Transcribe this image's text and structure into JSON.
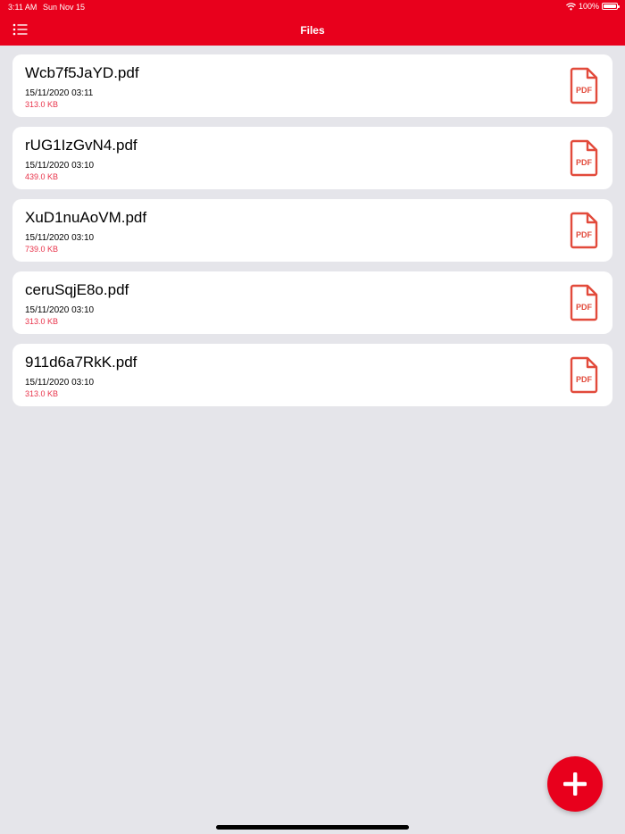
{
  "status_bar": {
    "time": "3:11 AM",
    "date": "Sun Nov 15",
    "battery": "100%"
  },
  "header": {
    "title": "Files"
  },
  "files": [
    {
      "name": "Wcb7f5JaYD.pdf",
      "date": "15/11/2020 03:11",
      "size": "313.0 KB",
      "icon_label": "PDF"
    },
    {
      "name": "rUG1IzGvN4.pdf",
      "date": "15/11/2020 03:10",
      "size": "439.0 KB",
      "icon_label": "PDF"
    },
    {
      "name": "XuD1nuAoVM.pdf",
      "date": "15/11/2020 03:10",
      "size": "739.0 KB",
      "icon_label": "PDF"
    },
    {
      "name": "ceruSqjE8o.pdf",
      "date": "15/11/2020 03:10",
      "size": "313.0 KB",
      "icon_label": "PDF"
    },
    {
      "name": "911d6a7RkK.pdf",
      "date": "15/11/2020 03:10",
      "size": "313.0 KB",
      "icon_label": "PDF"
    }
  ],
  "icons": {
    "menu": "list-menu-icon",
    "file": "pdf-file-icon",
    "add": "plus-icon",
    "wifi": "wifi-icon",
    "battery": "battery-icon"
  },
  "colors": {
    "accent": "#e8001c",
    "size_text": "#e8334a",
    "pdf_icon": "#e24a3b",
    "background": "#e5e5ea"
  }
}
